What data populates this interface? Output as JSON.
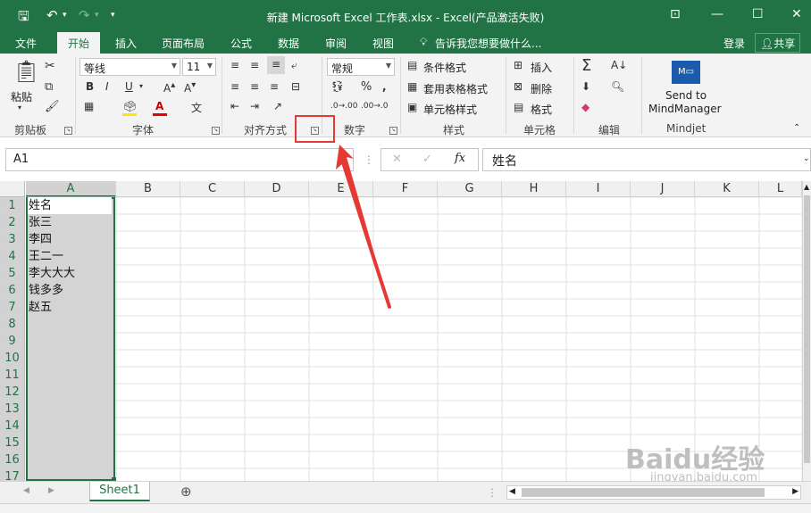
{
  "titlebar": {
    "title": "新建 Microsoft Excel 工作表.xlsx - Excel(产品激活失败)",
    "save_icon": "save-icon",
    "undo_icon": "undo-icon",
    "redo_icon": "redo-icon"
  },
  "menu": {
    "tabs": [
      "文件",
      "开始",
      "插入",
      "页面布局",
      "公式",
      "数据",
      "审阅",
      "视图"
    ],
    "tell_me": "告诉我您想要做什么...",
    "login": "登录",
    "share": "共享"
  },
  "ribbon": {
    "clipboard": {
      "paste": "粘贴",
      "label": "剪贴板"
    },
    "font": {
      "name": "等线",
      "size": "11",
      "label": "字体"
    },
    "alignment": {
      "label": "对齐方式"
    },
    "number": {
      "format": "常规",
      "label": "数字"
    },
    "styles": {
      "conditional": "条件格式",
      "table": "套用表格格式",
      "cell": "单元格样式",
      "label": "样式"
    },
    "cells": {
      "insert": "插入",
      "delete": "删除",
      "format": "格式",
      "label": "单元格"
    },
    "editing": {
      "label": "编辑"
    },
    "mindjet": {
      "send": "Send to",
      "app": "MindManager",
      "label": "Mindjet"
    }
  },
  "formula": {
    "namebox": "A1",
    "fx": "fx",
    "value": "姓名"
  },
  "sheet": {
    "columns": [
      "A",
      "B",
      "C",
      "D",
      "E",
      "F",
      "G",
      "H",
      "I",
      "J",
      "K",
      "L"
    ],
    "rows": [
      "1",
      "2",
      "3",
      "4",
      "5",
      "6",
      "7",
      "8",
      "9",
      "10",
      "11",
      "12",
      "13",
      "14",
      "15",
      "16",
      "17"
    ],
    "cells": [
      "姓名",
      "张三",
      "李四",
      "王二一",
      "李大大大",
      "钱多多",
      "赵五"
    ],
    "tab": "Sheet1"
  },
  "watermark": {
    "text": "Baidu经验",
    "url": "jingyan.baidu.com"
  }
}
